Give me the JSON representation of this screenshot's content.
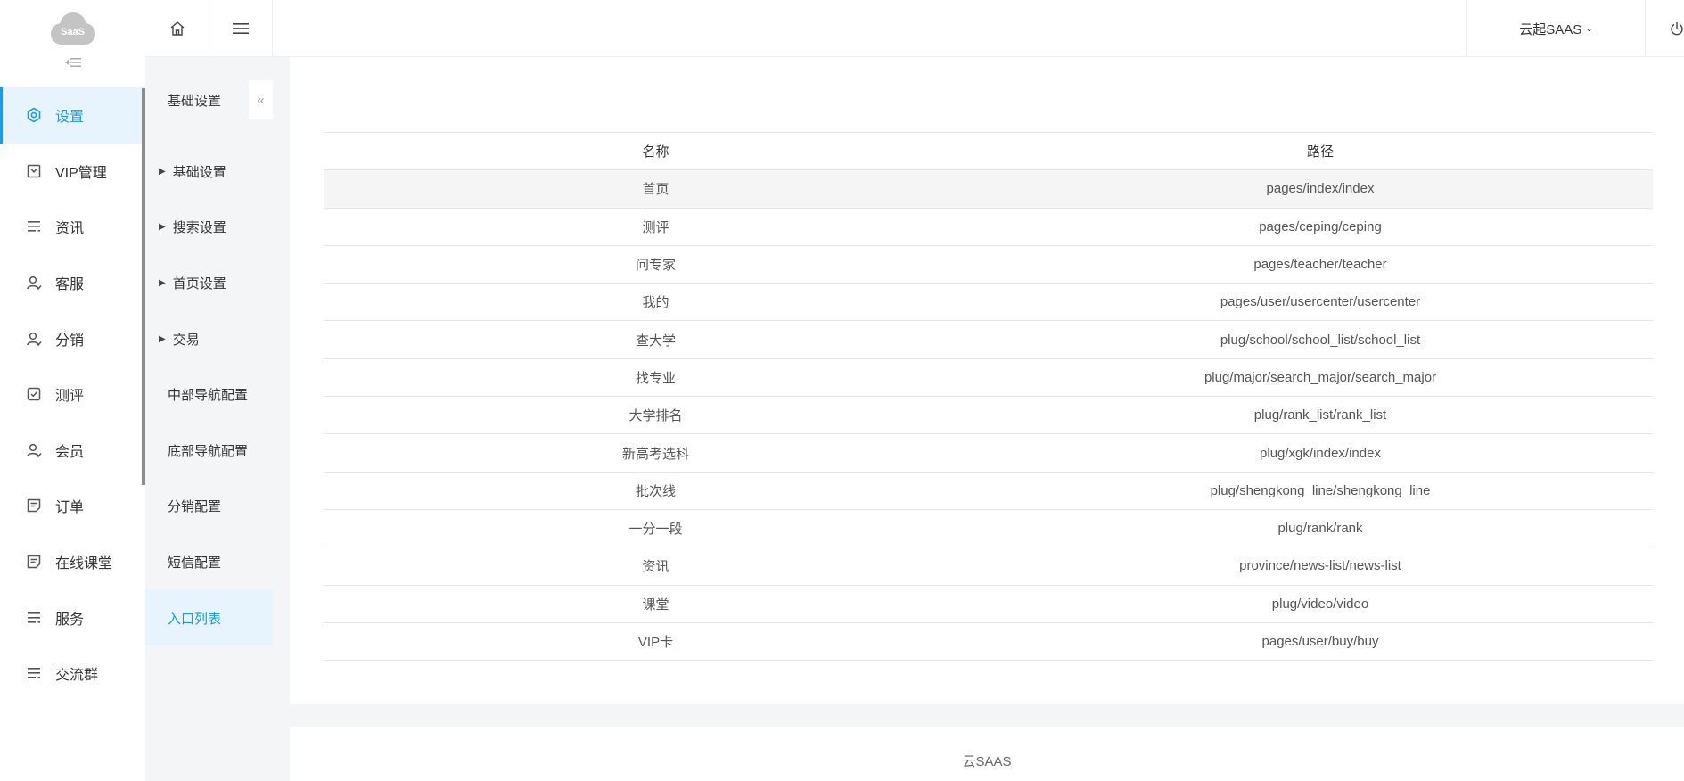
{
  "brand": {
    "logo_text": "SaaS"
  },
  "header": {
    "user_label": "云起SAAS"
  },
  "sidebar": {
    "items": [
      {
        "label": "设置",
        "icon": "gear-icon",
        "active": true
      },
      {
        "label": "VIP管理",
        "icon": "vip-icon"
      },
      {
        "label": "资讯",
        "icon": "list-icon"
      },
      {
        "label": "客服",
        "icon": "user-icon"
      },
      {
        "label": "分销",
        "icon": "user-icon"
      },
      {
        "label": "测评",
        "icon": "check-icon"
      },
      {
        "label": "会员",
        "icon": "user-icon"
      },
      {
        "label": "订单",
        "icon": "document-icon"
      },
      {
        "label": "在线课堂",
        "icon": "document-icon"
      },
      {
        "label": "服务",
        "icon": "list-icon"
      },
      {
        "label": "交流群",
        "icon": "list-icon"
      }
    ]
  },
  "subbar": {
    "title": "基础设置",
    "items": [
      {
        "label": "基础设置",
        "expandable": true
      },
      {
        "label": "搜索设置",
        "expandable": true
      },
      {
        "label": "首页设置",
        "expandable": true
      },
      {
        "label": "交易",
        "expandable": true
      },
      {
        "label": "中部导航配置"
      },
      {
        "label": "底部导航配置"
      },
      {
        "label": "分销配置"
      },
      {
        "label": "短信配置"
      },
      {
        "label": "入口列表",
        "active": true
      }
    ]
  },
  "table": {
    "columns": [
      "名称",
      "路径"
    ],
    "rows": [
      [
        "首页",
        "pages/index/index"
      ],
      [
        "测评",
        "pages/ceping/ceping"
      ],
      [
        "问专家",
        "pages/teacher/teacher"
      ],
      [
        "我的",
        "pages/user/usercenter/usercenter"
      ],
      [
        "查大学",
        "plug/school/school_list/school_list"
      ],
      [
        "找专业",
        "plug/major/search_major/search_major"
      ],
      [
        "大学排名",
        "plug/rank_list/rank_list"
      ],
      [
        "新高考选科",
        "plug/xgk/index/index"
      ],
      [
        "批次线",
        "plug/shengkong_line/shengkong_line"
      ],
      [
        "一分一段",
        "plug/rank/rank"
      ],
      [
        "资讯",
        "province/news-list/news-list"
      ],
      [
        "课堂",
        "plug/video/video"
      ],
      [
        "VIP卡",
        "pages/user/buy/buy"
      ]
    ]
  },
  "footer": {
    "text": "云SAAS"
  },
  "colors": {
    "accent": "#1b9be6",
    "active_bg": "#e8f4fd"
  }
}
